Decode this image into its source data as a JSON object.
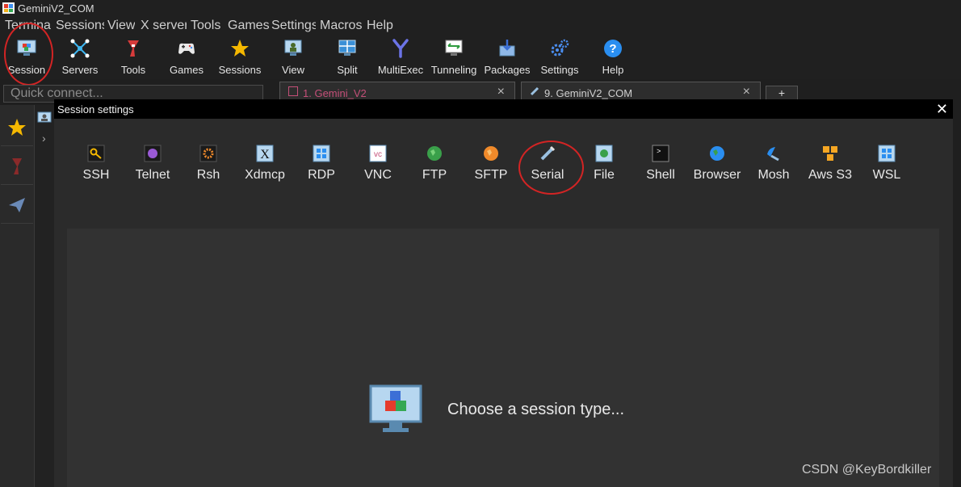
{
  "window": {
    "title": "GeminiV2_COM"
  },
  "menu": [
    "Termina",
    "Sessions",
    "View",
    "X server",
    "Tools",
    "Games",
    "Settings",
    "Macros",
    "Help"
  ],
  "toolbar": [
    {
      "label": "Session",
      "icon": "session-icon"
    },
    {
      "label": "Servers",
      "icon": "servers-icon"
    },
    {
      "label": "Tools",
      "icon": "tools-icon"
    },
    {
      "label": "Games",
      "icon": "games-icon"
    },
    {
      "label": "Sessions",
      "icon": "sessions-star-icon"
    },
    {
      "label": "View",
      "icon": "view-icon"
    },
    {
      "label": "Split",
      "icon": "split-icon"
    },
    {
      "label": "MultiExec",
      "icon": "multiexec-icon"
    },
    {
      "label": "Tunneling",
      "icon": "tunneling-icon"
    },
    {
      "label": "Packages",
      "icon": "packages-icon"
    },
    {
      "label": "Settings",
      "icon": "settings-icon"
    },
    {
      "label": "Help",
      "icon": "help-icon"
    }
  ],
  "quick_connect": {
    "placeholder": "Quick connect..."
  },
  "tabs": [
    {
      "label": "1. Gemini_V2",
      "close": "×"
    },
    {
      "label": "9. GeminiV2_COM",
      "close": "×"
    }
  ],
  "new_tab": "+",
  "dialog": {
    "title": "Session settings",
    "close": "✕",
    "session_types": [
      "SSH",
      "Telnet",
      "Rsh",
      "Xdmcp",
      "RDP",
      "VNC",
      "FTP",
      "SFTP",
      "Serial",
      "File",
      "Shell",
      "Browser",
      "Mosh",
      "Aws S3",
      "WSL"
    ],
    "prompt": "Choose a session type..."
  },
  "watermark": "CSDN @KeyBordkiller",
  "colors": {
    "highlight_ring": "#d32424",
    "background": "#1f1f1f",
    "dialog": "#2b2b2b",
    "content": "#323232"
  }
}
